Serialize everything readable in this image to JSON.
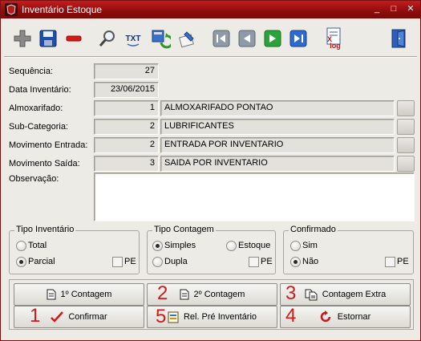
{
  "window": {
    "title": "Inventário Estoque",
    "controls": {
      "minimize": "_",
      "maximize": "□",
      "close": "✕"
    }
  },
  "toolbar": {
    "icons": [
      "plus-icon",
      "save-icon",
      "delete-icon",
      "search-icon",
      "txt-export-icon",
      "refresh-icon",
      "edit-icon",
      "first-icon",
      "previous-icon",
      "next-icon",
      "last-icon",
      "log-icon",
      "exit-icon"
    ],
    "txt_label": "TXT",
    "log_label": "log"
  },
  "form": {
    "sequencia": {
      "label": "Sequência:",
      "value": "27"
    },
    "data": {
      "label": "Data Inventário:",
      "value": "23/06/2015"
    },
    "almoxarifado": {
      "label": "Almoxarifado:",
      "code": "1",
      "name": "ALMOXARIFADO PONTAO"
    },
    "subcategoria": {
      "label": "Sub-Categoria:",
      "code": "2",
      "name": "LUBRIFICANTES"
    },
    "mov_entrada": {
      "label": "Movimento Entrada:",
      "code": "2",
      "name": "ENTRADA POR INVENTARIO"
    },
    "mov_saida": {
      "label": "Movimento Saída:",
      "code": "3",
      "name": "SAIDA POR INVENTARIO"
    },
    "observacao": {
      "label": "Observação:",
      "value": ""
    }
  },
  "groups": {
    "tipo_inventario": {
      "title": "Tipo Inventário",
      "opt1": "Total",
      "opt2": "Parcial",
      "pe": "PE",
      "selected": "Parcial"
    },
    "tipo_contagem": {
      "title": "Tipo Contagem",
      "opt1": "Simples",
      "opt2": "Estoque",
      "opt3": "Dupla",
      "pe": "PE",
      "selected": "Simples"
    },
    "confirmado": {
      "title": "Confirmado",
      "opt1": "Sim",
      "opt2": "Não",
      "pe": "PE",
      "selected": "Não"
    }
  },
  "buttons": {
    "contagem1": "1º Contagem",
    "contagem2": "2º Contagem",
    "contagem_extra": "Contagem Extra",
    "confirmar": "Confirmar",
    "rel_pre": "Rel. Pré Inventário",
    "estornar": "Estornar"
  },
  "annotations": {
    "a1": "1",
    "a2": "2",
    "a3": "3",
    "a4": "4",
    "a5": "5"
  },
  "colors": {
    "titlebar": "#a01414",
    "annotation": "#d11a1a"
  }
}
